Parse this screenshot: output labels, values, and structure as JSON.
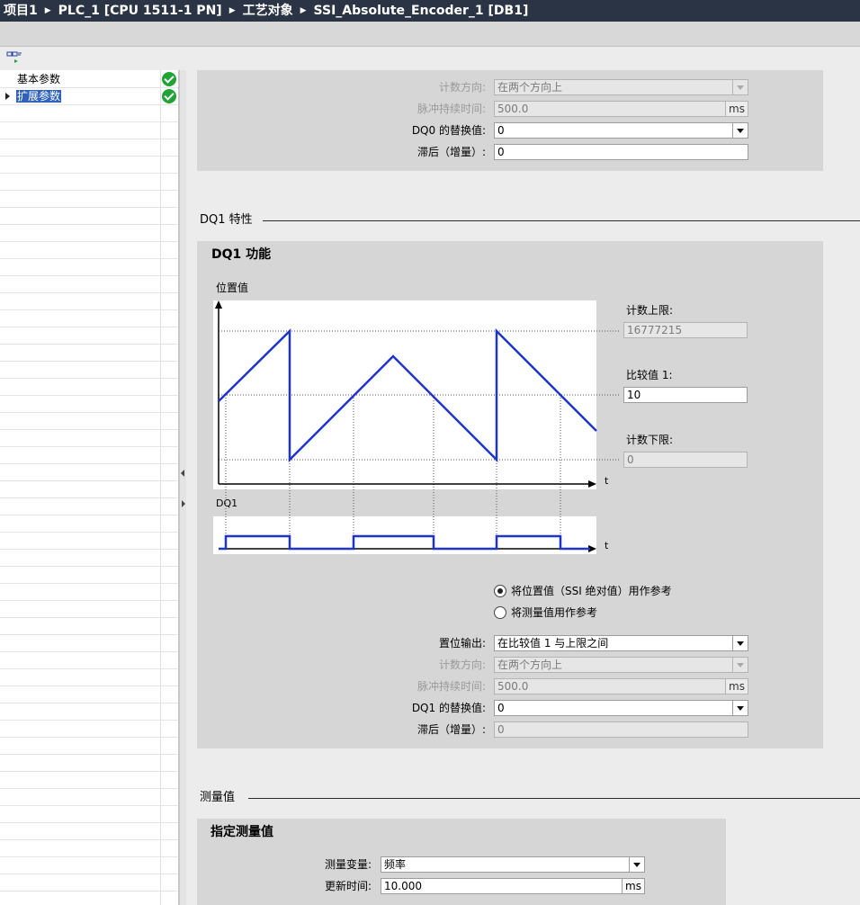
{
  "breadcrumb": [
    "项目1",
    "PLC_1 [CPU 1511-1 PN]",
    "工艺对象",
    "SSI_Absolute_Encoder_1 [DB1]"
  ],
  "nav": {
    "items": [
      {
        "label": "基本参数",
        "status": "ok"
      },
      {
        "label": "扩展参数",
        "status": "ok",
        "selected": true
      }
    ]
  },
  "dq0": {
    "count_direction_label": "计数方向:",
    "count_direction_value": "在两个方向上",
    "pulse_duration_label": "脉冲持续时间:",
    "pulse_duration_value": "500.0",
    "pulse_duration_unit": "ms",
    "substitute_label": "DQ0 的替换值:",
    "substitute_value": "0",
    "hysteresis_label": "滞后（增量）:",
    "hysteresis_value": "0"
  },
  "dq1": {
    "section_title": "DQ1 特性",
    "panel_title": "DQ1 功能",
    "chart": {
      "y_label": "位置值",
      "x_label": "t",
      "dq_label": "DQ1",
      "upper_limit_label": "计数上限:",
      "upper_limit_value": "16777215",
      "compare_label": "比较值 1:",
      "compare_value": "10",
      "lower_limit_label": "计数下限:",
      "lower_limit_value": "0"
    },
    "reference_options": [
      {
        "label": "将位置值（SSI 绝对值）用作参考",
        "checked": true
      },
      {
        "label": "将测量值用作参考",
        "checked": false
      }
    ],
    "set_output_label": "置位输出:",
    "set_output_value": "在比较值 1 与上限之间",
    "count_direction_label": "计数方向:",
    "count_direction_value": "在两个方向上",
    "pulse_duration_label": "脉冲持续时间:",
    "pulse_duration_value": "500.0",
    "pulse_duration_unit": "ms",
    "substitute_label": "DQ1 的替换值:",
    "substitute_value": "0",
    "hysteresis_label": "滞后（增量）:",
    "hysteresis_value": "0"
  },
  "measurement": {
    "section_title": "测量值",
    "panel_title": "指定测量值",
    "variable_label": "测量变量:",
    "variable_value": "频率",
    "update_time_label": "更新时间:",
    "update_time_value": "10.000",
    "update_time_unit": "ms"
  },
  "colors": {
    "accent": "#2f62b8",
    "signal": "#1f35c8",
    "ok": "#21a336",
    "title_bar": "#2b3444"
  }
}
